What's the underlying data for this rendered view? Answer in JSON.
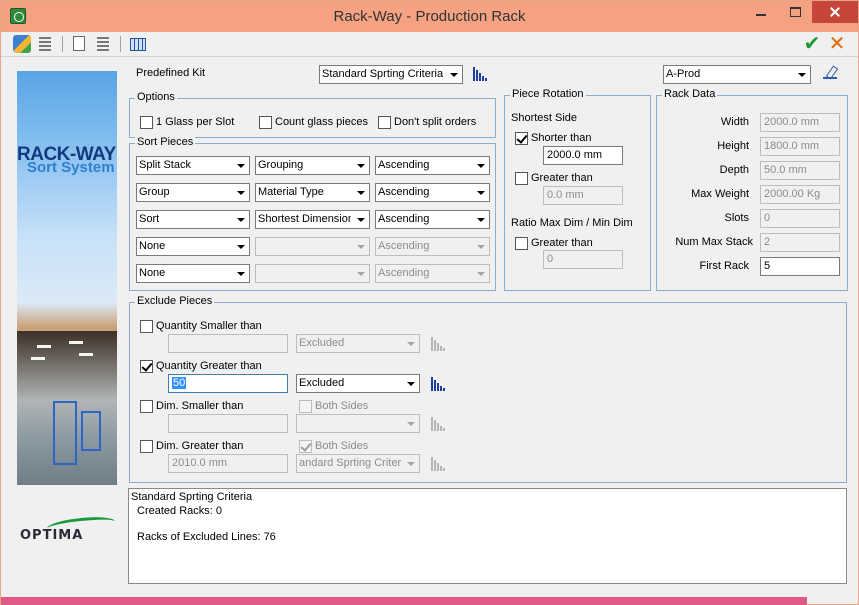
{
  "window": {
    "title": "Rack-Way - Production Rack",
    "accent": "#f4a282",
    "close_color": "#c7463b"
  },
  "toolbar": {
    "left_icons": [
      "open-icon",
      "list-icon",
      "new-document-icon",
      "list-icon",
      "table-icon"
    ],
    "right_icons": [
      "checkmark-icon",
      "cancel-icon"
    ]
  },
  "banner": {
    "title": "RACK-WAY",
    "subtitle": "Sort System",
    "logo": "OPTIMA"
  },
  "predefined_kit": {
    "label": "Predefined Kit",
    "value": "Standard Sprting Criteria",
    "rack_value": "A-Prod"
  },
  "options": {
    "title": "Options",
    "one_glass": "1 Glass per Slot",
    "count_glass": "Count glass pieces",
    "dont_split": "Don't split orders"
  },
  "sort_pieces": {
    "title": "Sort Pieces",
    "rows": [
      {
        "first": "Split Stack",
        "second": "Grouping",
        "order": "Ascending",
        "enabled": true
      },
      {
        "first": "Group",
        "second": "Material Type",
        "order": "Ascending",
        "enabled": true
      },
      {
        "first": "Sort",
        "second": "Shortest Dimension",
        "order": "Ascending",
        "enabled": true
      },
      {
        "first": "None",
        "second": "",
        "order": "Ascending",
        "enabled": false
      },
      {
        "first": "None",
        "second": "",
        "order": "Ascending",
        "enabled": false
      }
    ]
  },
  "piece_rotation": {
    "title": "Piece Rotation",
    "shortest_side": "Shortest Side",
    "shorter_than": "Shorter than",
    "shorter_value": "2000.0 mm",
    "greater_than": "Greater than",
    "greater_value": "0.0 mm",
    "ratio_label": "Ratio Max Dim / Min Dim",
    "ratio_greater": "Greater than",
    "ratio_value": "0"
  },
  "rack_data": {
    "title": "Rack Data",
    "fields": [
      {
        "label": "Width",
        "value": "2000.0 mm",
        "enabled": false
      },
      {
        "label": "Height",
        "value": "1800.0 mm",
        "enabled": false
      },
      {
        "label": "Depth",
        "value": "50.0 mm",
        "enabled": false
      },
      {
        "label": "Max Weight",
        "value": "2000.00 Kg",
        "enabled": false
      },
      {
        "label": "Slots",
        "value": "0",
        "enabled": false
      },
      {
        "label": "Num Max Stack",
        "value": "2",
        "enabled": false
      },
      {
        "label": "First Rack",
        "value": "5",
        "enabled": true
      }
    ]
  },
  "exclude_pieces": {
    "title": "Exclude Pieces",
    "qty_smaller": {
      "label": "Quantity Smaller than",
      "value": "",
      "mode": "Excluded"
    },
    "qty_greater": {
      "label": "Quantity Greater than",
      "value": "50",
      "mode": "Excluded"
    },
    "dim_smaller": {
      "label": "Dim. Smaller than",
      "value": "",
      "both": "Both Sides",
      "criteria": ""
    },
    "dim_greater": {
      "label": "Dim. Greater than",
      "value": "2010.0 mm",
      "both": "Both Sides",
      "criteria": "andard Sprting Criteria"
    }
  },
  "info": {
    "line1": "Standard Sprting Criteria",
    "line2": "Created Racks: 0",
    "line3": "Racks of Excluded Lines: 76"
  }
}
